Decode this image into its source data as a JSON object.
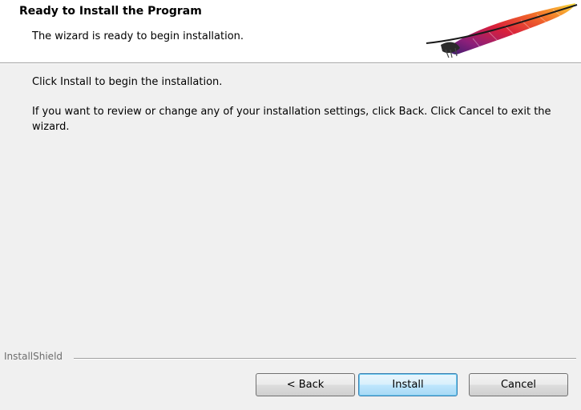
{
  "header": {
    "title": "Ready to Install the Program",
    "subtitle": "The wizard is ready to begin installation.",
    "logo_icon": "apache-feather-icon"
  },
  "body": {
    "line1": "Click Install to begin the installation.",
    "line2": "If you want to review or change any of your installation settings, click Back. Click Cancel to exit the wizard."
  },
  "footer": {
    "brand": "InstallShield",
    "back_label": "< Back",
    "install_label": "Install",
    "cancel_label": "Cancel"
  },
  "colors": {
    "background": "#f0f0f0",
    "header_background": "#ffffff",
    "default_button_border": "#3c7fb1"
  }
}
